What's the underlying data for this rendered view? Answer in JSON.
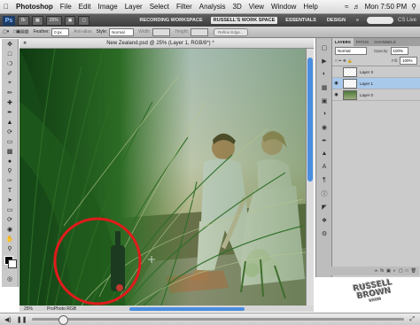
{
  "menubar": {
    "items": [
      "Photoshop",
      "File",
      "Edit",
      "Image",
      "Layer",
      "Select",
      "Filter",
      "Analysis",
      "3D",
      "View",
      "Window",
      "Help"
    ],
    "clock": "Mon 7:50 PM"
  },
  "appbar": {
    "logo": "Ps",
    "zoom": "25%",
    "workspaces": [
      "RECORDING WORKSPACE",
      "RUSSELL'S WORK SPACE",
      "ESSENTIALS",
      "DESIGN"
    ],
    "more": "»",
    "cs_live": "CS Live"
  },
  "options": {
    "feather_label": "Feather:",
    "feather_value": "0 px",
    "antialias_label": "Anti-alias",
    "style_label": "Style:",
    "style_value": "Normal",
    "width_label": "Width:",
    "height_label": "Height:",
    "refine_label": "Refine Edge..."
  },
  "document": {
    "title": "New Zealand.psd @ 25% (Layer 1, RGB/8*) *",
    "zoom": "25%",
    "profile": "ProPhoto RGB"
  },
  "layers_panel": {
    "tabs": [
      "LAYERS",
      "PATHS",
      "CHANNELS"
    ],
    "blend_mode": "Normal",
    "opacity_label": "Opacity:",
    "opacity_value": "100%",
    "fill_label": "Fill:",
    "fill_value": "100%",
    "layers": [
      {
        "name": "Layer 3",
        "visible": false,
        "selected": false
      },
      {
        "name": "Layer 1",
        "visible": true,
        "selected": true
      },
      {
        "name": "Layer 0",
        "visible": true,
        "selected": false
      }
    ]
  },
  "watermark": {
    "line1": "RUSSELL",
    "line2": "BROWN",
    "line3": "SHOW"
  },
  "colors": {
    "accent_red": "#e01b1b",
    "selection_blue": "#a9c9ea",
    "appbar_dark": "#4a4a4a"
  },
  "player": {
    "progress": 0.08
  }
}
